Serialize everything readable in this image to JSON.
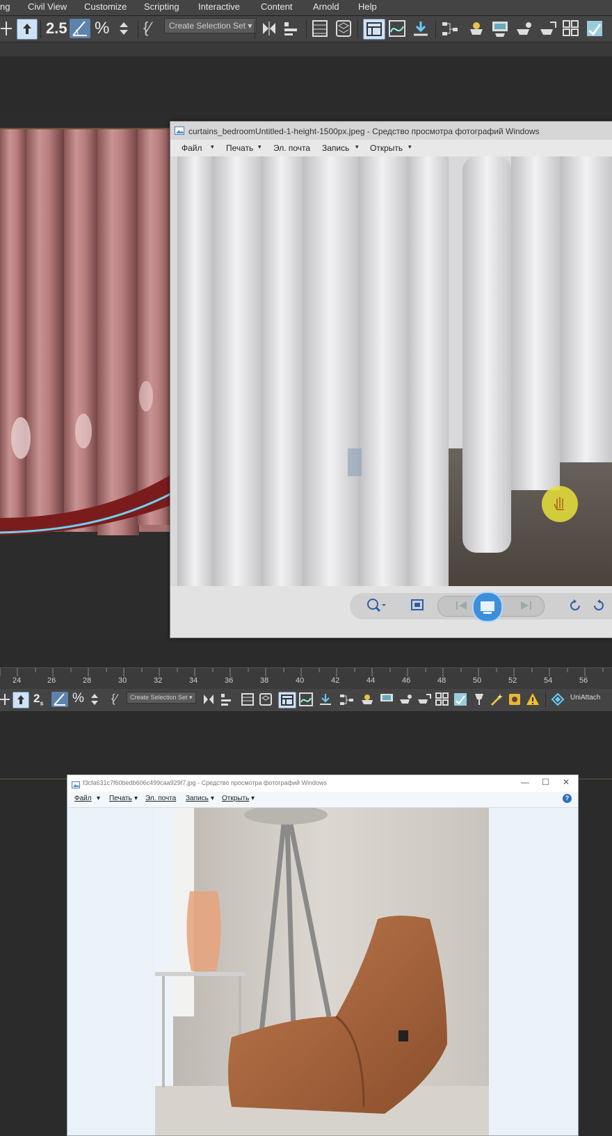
{
  "menu": {
    "items": [
      "ng",
      "Civil View",
      "Customize",
      "Scripting",
      "Interactive",
      "Content",
      "Arnold",
      "Help"
    ]
  },
  "toolbar": {
    "selection_set": "Create Selection Set",
    "snap_label": "2.5",
    "uniattach_label": "UniAttach"
  },
  "viewer1": {
    "title": "curtains_bedroomUntitled-1-height-1500px.jpeg - Средство просмотра фотографий Windows",
    "menu": [
      "Файл",
      "Печать",
      "Эл. почта",
      "Запись",
      "Открыть"
    ]
  },
  "timeline": {
    "ticks": [
      "24",
      "26",
      "28",
      "30",
      "32",
      "34",
      "36",
      "38",
      "40",
      "42",
      "44",
      "46",
      "48",
      "50",
      "52",
      "54",
      "56"
    ]
  },
  "viewer2": {
    "title": "f3cfa631c7f60bedb606c499caa929f7.jpg - Средство просмотра фотографий Windows",
    "menu": [
      "Файл",
      "Печать",
      "Эл. почта",
      "Запись",
      "Открыть"
    ],
    "minimize": "—",
    "maximize": "☐",
    "close": "✕",
    "help": "?"
  },
  "colors": {
    "max_bg": "#2b2b2b",
    "toolbar": "#444444",
    "highlight_button": "#5d82ad",
    "curtain_pink": "#b77f7e",
    "spline_cyan": "#6fd0f0",
    "cursor_yellow": "#e8e23a"
  }
}
